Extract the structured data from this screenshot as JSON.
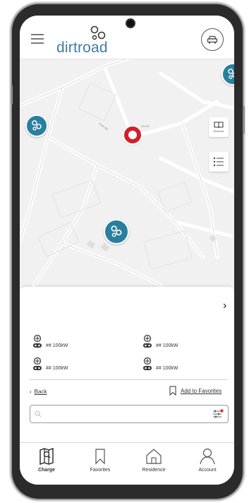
{
  "app": {
    "brand": "dirtroad"
  },
  "colors": {
    "brand": "#3d7fa1",
    "station": "#2a7f9e",
    "user_pin": "#d0202a",
    "filter_dot": "#e03030"
  },
  "header": {
    "menu_icon": "hamburger-icon",
    "vehicle_icon": "car-icon"
  },
  "map": {
    "user_location_label": "HOOD",
    "road_label": "Park Rd",
    "tools": {
      "reserve_icon": "book-icon",
      "reserve_label": "Reserve",
      "list_icon": "list-icon"
    },
    "stations": [
      {
        "icon": "charger-station-icon"
      },
      {
        "icon": "charger-station-icon"
      },
      {
        "icon": "charger-station-icon"
      }
    ]
  },
  "sheet": {
    "chevron": "›",
    "connectors": [
      {
        "count": "##",
        "power": "100kW"
      },
      {
        "count": "##",
        "power": "100kW"
      },
      {
        "count": "##",
        "power": "100kW"
      },
      {
        "count": "##",
        "power": "100kW"
      }
    ],
    "back_arrow": "‹",
    "back_label": "Back",
    "favorite_label": "Add to Favorites",
    "search": {
      "placeholder": "",
      "value": ""
    }
  },
  "tabs": [
    {
      "label": "Charge",
      "icon": "map-icon",
      "active": true
    },
    {
      "label": "Favorites",
      "icon": "bookmark-icon",
      "active": false
    },
    {
      "label": "Residence",
      "icon": "home-icon",
      "active": false
    },
    {
      "label": "Account",
      "icon": "person-icon",
      "active": false
    }
  ]
}
